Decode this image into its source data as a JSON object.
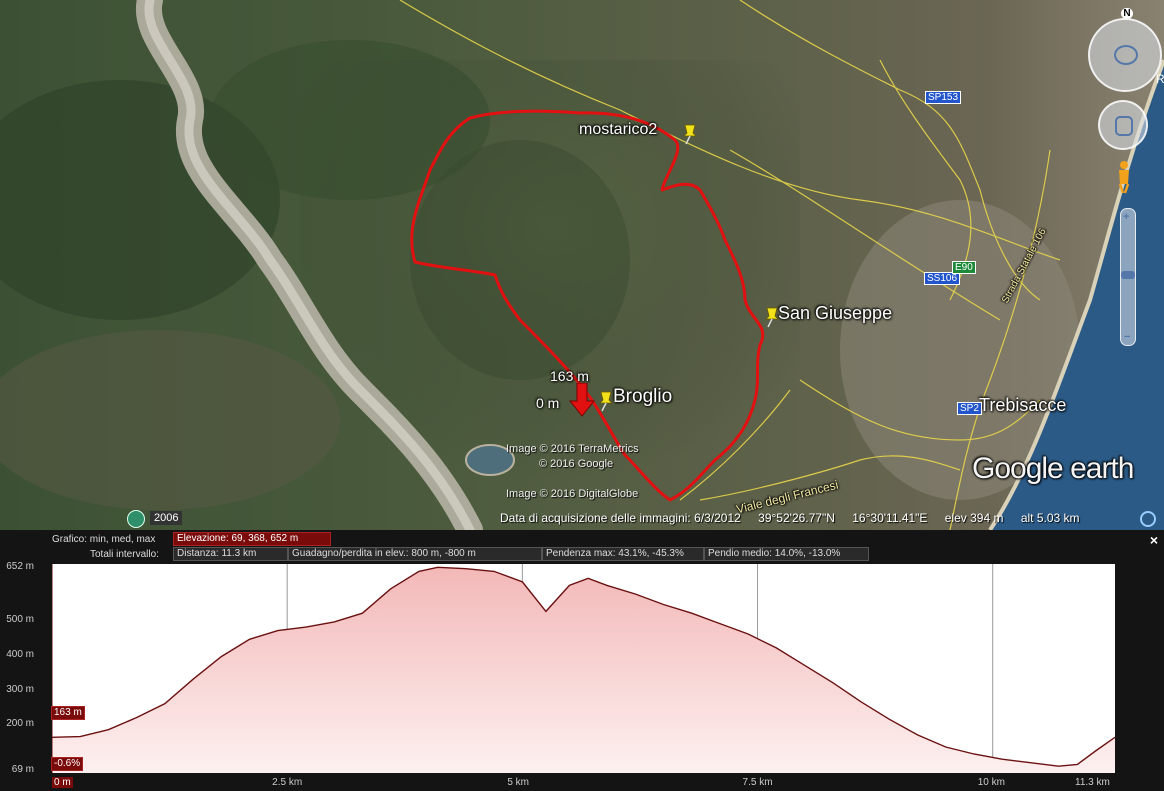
{
  "map": {
    "labels": {
      "mostarico": "mostarico2",
      "san_giuseppe": "San Giuseppe",
      "broglio": "Broglio",
      "trebisacce": "Trebisacce",
      "point_elev": "163 m",
      "point_dist": "0 m"
    },
    "roads": {
      "sp153": "SP153",
      "ss106": "SS106",
      "e90": "E90",
      "sp2": "SP2",
      "viale": "Viale degli Francesi",
      "statale": "Strada Statale 106"
    },
    "credits": {
      "terrametrics": "Image © 2016 TerraMetrics",
      "google": "© 2016 Google",
      "digitalglobe": "Image © 2016 DigitalGlobe"
    },
    "logo": "Google earth",
    "history_year": "2006",
    "status": {
      "acquisition": "Data di acquisizione delle immagini: 6/3/2012",
      "lat": "39°52'26.77\"N",
      "lon": "16°30'11.41\"E",
      "elev": "elev   394 m",
      "alt": "alt   5.03 km"
    },
    "compass_north": "N",
    "edge_letter": "R"
  },
  "profile": {
    "header": {
      "grafico_label": "Grafico: min, med, max",
      "elevazione": "Elevazione: 69, 368, 652 m",
      "totali_label": "Totali intervallo:",
      "distanza": "Distanza: 11.3 km",
      "guadagno": "Guadagno/perdita in elev.: 800 m, -800 m",
      "pendenza": "Pendenza max: 43.1%, -45.3%",
      "pendio": "Pendio medio: 14.0%, -13.0%"
    },
    "current_elev_tag": "163 m",
    "current_slope_tag": "-0.6%",
    "close": "×"
  },
  "chart_data": {
    "type": "area",
    "xlabel": "",
    "ylabel": "",
    "x_tick_labels": [
      "0 m",
      "2.5 km",
      "5 km",
      "7.5 km",
      "10 km",
      "11.3 km"
    ],
    "y_tick_labels": [
      "69 m",
      "200 m",
      "300 m",
      "400 m",
      "500 m",
      "652 m"
    ],
    "xlim_km": [
      0,
      11.3
    ],
    "ylim_m": [
      69,
      652
    ],
    "grid": true,
    "series": [
      {
        "x_km": [
          0,
          0.3,
          0.6,
          0.9,
          1.2,
          1.5,
          1.8,
          2.1,
          2.4,
          2.7,
          3.0,
          3.3,
          3.6,
          3.9,
          4.1,
          4.4,
          4.7,
          5.0,
          5.25,
          5.5,
          5.7,
          5.9,
          6.2,
          6.5,
          6.8,
          7.1,
          7.4,
          7.7,
          8.0,
          8.3,
          8.6,
          8.9,
          9.2,
          9.5,
          9.8,
          10.1,
          10.4,
          10.7,
          10.9,
          11.1,
          11.3
        ],
        "elev_m": [
          163,
          165,
          185,
          220,
          260,
          330,
          395,
          445,
          470,
          480,
          495,
          520,
          590,
          640,
          652,
          648,
          640,
          610,
          525,
          600,
          620,
          600,
          575,
          545,
          520,
          490,
          460,
          420,
          370,
          320,
          265,
          215,
          170,
          135,
          115,
          100,
          90,
          80,
          85,
          125,
          163
        ]
      }
    ]
  }
}
